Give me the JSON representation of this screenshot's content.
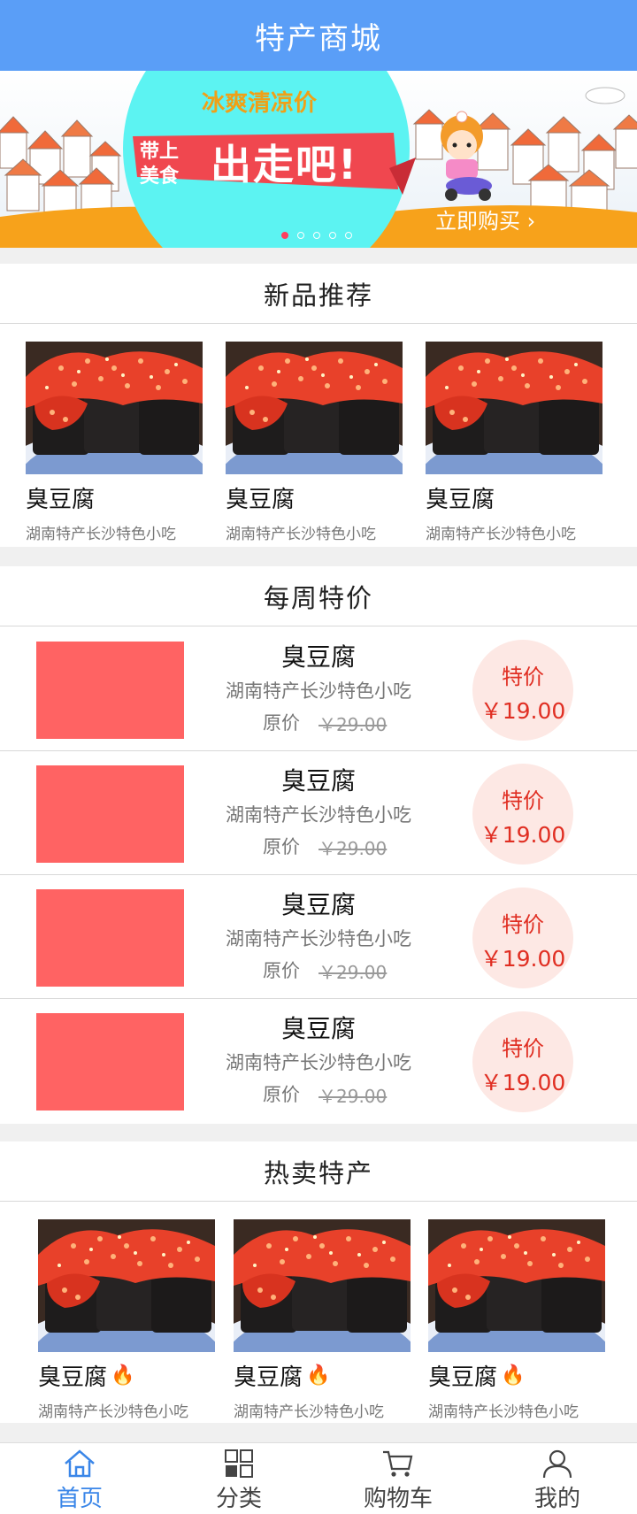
{
  "header": {
    "title": "特产商城"
  },
  "banner": {
    "headline": "冰爽清凉价",
    "tag": "带上美食",
    "slogan": "出走吧!",
    "buy_label": "立即购买 ›",
    "dots": 5,
    "active_dot": 0
  },
  "new_products": {
    "title": "新品推荐",
    "items": [
      {
        "name": "臭豆腐",
        "desc": "湖南特产长沙特色小吃"
      },
      {
        "name": "臭豆腐",
        "desc": "湖南特产长沙特色小吃"
      },
      {
        "name": "臭豆腐",
        "desc": "湖南特产长沙特色小吃"
      }
    ]
  },
  "weekly": {
    "title": "每周特价",
    "orig_label": "原价",
    "special_label": "特价",
    "items": [
      {
        "name": "臭豆腐",
        "desc": "湖南特产长沙特色小吃",
        "orig_price": "￥29.00",
        "price": "￥19.00"
      },
      {
        "name": "臭豆腐",
        "desc": "湖南特产长沙特色小吃",
        "orig_price": "￥29.00",
        "price": "￥19.00"
      },
      {
        "name": "臭豆腐",
        "desc": "湖南特产长沙特色小吃",
        "orig_price": "￥29.00",
        "price": "￥19.00"
      },
      {
        "name": "臭豆腐",
        "desc": "湖南特产长沙特色小吃",
        "orig_price": "￥29.00",
        "price": "￥19.00"
      }
    ]
  },
  "hot": {
    "title": "热卖特产",
    "items": [
      {
        "name": "臭豆腐",
        "desc": "湖南特产长沙特色小吃"
      },
      {
        "name": "臭豆腐",
        "desc": "湖南特产长沙特色小吃"
      },
      {
        "name": "臭豆腐",
        "desc": "湖南特产长沙特色小吃"
      }
    ]
  },
  "tabbar": {
    "items": [
      {
        "label": "首页",
        "icon": "home-icon",
        "active": true
      },
      {
        "label": "分类",
        "icon": "category-icon",
        "active": false
      },
      {
        "label": "购物车",
        "icon": "cart-icon",
        "active": false
      },
      {
        "label": "我的",
        "icon": "user-icon",
        "active": false
      }
    ]
  },
  "colors": {
    "header": "#5a9ef7",
    "accent_red": "#e02e22",
    "thumb": "#ff6363",
    "badge_bg": "#fde8e4",
    "tab_active": "#3a86e8"
  }
}
